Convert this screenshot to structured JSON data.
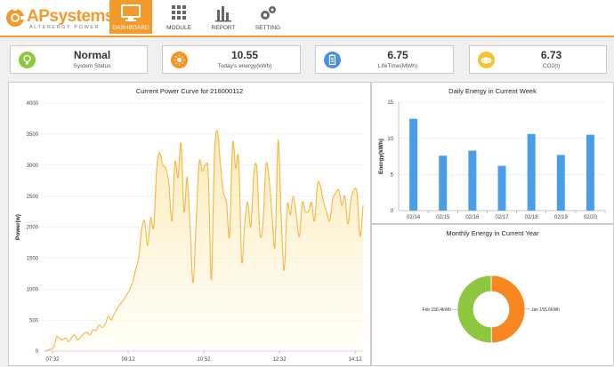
{
  "brand": {
    "name_prefix": "AP",
    "name_suffix": "systems",
    "tagline": "ALTENERGY POWER",
    "accent_color": "#f39a2b"
  },
  "nav": [
    {
      "label": "DASHBOARD",
      "icon": "monitor-icon",
      "active": true
    },
    {
      "label": "MODULE",
      "icon": "grid-icon",
      "active": false
    },
    {
      "label": "REPORT",
      "icon": "bar-chart-icon",
      "active": false
    },
    {
      "label": "SETTING",
      "icon": "gears-icon",
      "active": false
    }
  ],
  "stats": [
    {
      "value": "Normal",
      "label": "System Status",
      "icon": "lightbulb-icon",
      "color": "#8dc63f"
    },
    {
      "value": "10.55",
      "label": "Today's energy(kWh)",
      "icon": "sun-icon",
      "color": "#f7931e"
    },
    {
      "value": "6.75",
      "label": "LifeTime(MWh)",
      "icon": "battery-icon",
      "color": "#4a90e2"
    },
    {
      "value": "6.73",
      "label": "CO2(t)",
      "icon": "co2-icon",
      "color": "#f4c430"
    }
  ],
  "power_chart": {
    "title": "Current Power Curve for 216000112",
    "chart_data": {
      "type": "area",
      "ylabel": "Power(w)",
      "ylim": [
        0,
        4000
      ],
      "yticks": [
        "0",
        "500",
        "1000",
        "1500",
        "2000",
        "2500",
        "3000",
        "3500",
        "4000"
      ],
      "xticks": [
        "07:32",
        "09:12",
        "10:52",
        "12:32",
        "14:12"
      ],
      "x_range_minutes": [
        452,
        872
      ],
      "color": "#f4b63f",
      "series": [
        {
          "x": [
            452,
            458,
            464,
            468,
            472,
            476,
            480,
            484,
            488,
            492,
            496,
            500,
            504,
            508,
            512,
            516,
            520,
            524,
            528,
            532,
            536,
            540,
            544,
            548,
            552,
            556,
            560,
            564,
            568,
            572,
            576,
            580,
            584,
            588,
            592,
            596,
            600,
            604,
            608,
            612,
            616,
            620,
            624,
            628,
            632,
            636,
            640,
            644,
            648,
            652,
            656,
            660,
            664,
            668,
            672,
            676,
            680,
            684,
            688,
            692,
            696,
            700,
            704,
            708,
            712,
            716,
            720,
            724,
            728,
            732,
            736,
            740,
            744,
            748,
            752,
            756,
            760,
            764,
            768,
            772,
            776,
            780,
            784,
            788,
            792,
            796,
            800,
            804,
            808,
            812,
            816,
            820,
            824,
            828,
            832,
            836,
            840,
            844,
            848,
            852,
            856,
            860,
            864,
            868,
            872
          ],
          "values": [
            0,
            20,
            60,
            230,
            200,
            180,
            210,
            150,
            220,
            260,
            180,
            230,
            280,
            300,
            260,
            340,
            330,
            420,
            380,
            430,
            560,
            500,
            600,
            680,
            760,
            820,
            900,
            980,
            1100,
            1300,
            1500,
            1950,
            2100,
            1700,
            2150,
            2000,
            2950,
            3200,
            3000,
            2950,
            2700,
            2100,
            3050,
            2800,
            3350,
            2250,
            2800,
            2000,
            1100,
            2100,
            3050,
            2900,
            3000,
            2850,
            1150,
            3150,
            3550,
            3000,
            2550,
            2400,
            1850,
            3350,
            2950,
            3100,
            1450,
            2050,
            2400,
            2000,
            2850,
            2950,
            1900,
            2050,
            3000,
            2800,
            2200,
            1700,
            3400,
            2200,
            1300,
            2350,
            2200,
            2500,
            2200,
            1850,
            2400,
            2250,
            2250,
            2400,
            2100,
            2700,
            2650,
            2400,
            2250,
            2100,
            2450,
            2550,
            2600,
            2350,
            2500,
            2050,
            2450,
            2600,
            2550,
            1850,
            2350
          ]
        }
      ]
    }
  },
  "daily_chart": {
    "title": "Daily Energy in Current Week",
    "chart_data": {
      "type": "bar",
      "ylabel": "Energy(kWh)",
      "ylim": [
        0,
        15
      ],
      "yticks": [
        "0",
        "5",
        "10",
        "15"
      ],
      "categories": [
        "02/14",
        "02/15",
        "02/16",
        "02/17",
        "02/18",
        "02/19",
        "02/20"
      ],
      "values": [
        12.7,
        7.6,
        8.3,
        6.2,
        10.6,
        7.7,
        10.5
      ],
      "color": "#4a9ee8"
    }
  },
  "monthly_chart": {
    "title": "Monthly Energy in Current Year",
    "chart_data": {
      "type": "pie",
      "donut": true,
      "slices": [
        {
          "label": "Jan 155.6kWh",
          "value": 155.6,
          "color": "#f7871e"
        },
        {
          "label": "Feb 156.4kWh",
          "value": 156.4,
          "color": "#8dc63f"
        }
      ]
    }
  }
}
